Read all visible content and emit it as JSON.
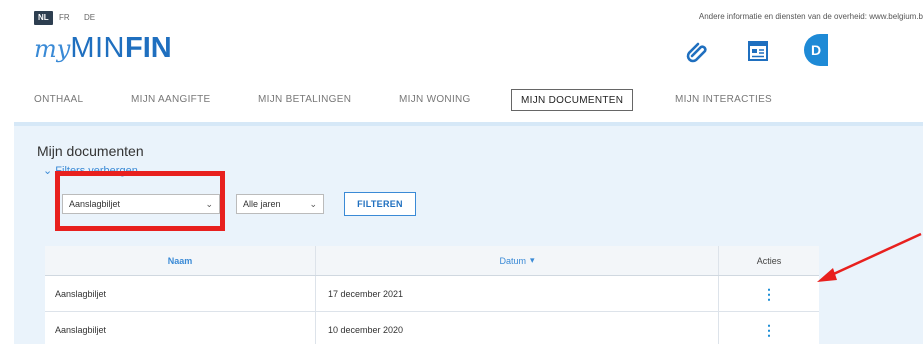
{
  "languages": [
    {
      "code": "NL",
      "active": true
    },
    {
      "code": "FR",
      "active": false
    },
    {
      "code": "DE",
      "active": false
    }
  ],
  "gov_link": "Andere informatie en diensten van de overheid: www.belgium.b",
  "logo": {
    "prefix": "my",
    "part1": "MIN",
    "part2": "FIN"
  },
  "header_icons": [
    "paperclip-icon",
    "document-icon",
    "profile-icon"
  ],
  "profile_icon_glyph": "D",
  "nav": [
    {
      "label": "ONTHAAL",
      "active": false
    },
    {
      "label": "MIJN AANGIFTE",
      "active": false
    },
    {
      "label": "MIJN BETALINGEN",
      "active": false
    },
    {
      "label": "MIJN WONING",
      "active": false
    },
    {
      "label": "MIJN DOCUMENTEN",
      "active": true
    },
    {
      "label": "MIJN INTERACTIES",
      "active": false
    }
  ],
  "main": {
    "title": "Mijn documenten",
    "filter_toggle": "Filters verbergen",
    "filters": {
      "type_value": "Aanslagbiljet",
      "year_value": "Alle jaren",
      "filter_button": "FILTEREN"
    }
  },
  "table": {
    "columns": {
      "name": "Naam",
      "date": "Datum",
      "actions": "Acties"
    },
    "sort_indicator": "▾",
    "rows": [
      {
        "name": "Aanslagbiljet",
        "date": "17 december 2021"
      },
      {
        "name": "Aanslagbiljet",
        "date": "10 december 2020"
      }
    ]
  },
  "colors": {
    "brand_blue": "#1f6fbf",
    "accent_blue": "#3a8ad6",
    "panel_bg": "#eaf3fb",
    "annotation_red": "#e8201e"
  }
}
